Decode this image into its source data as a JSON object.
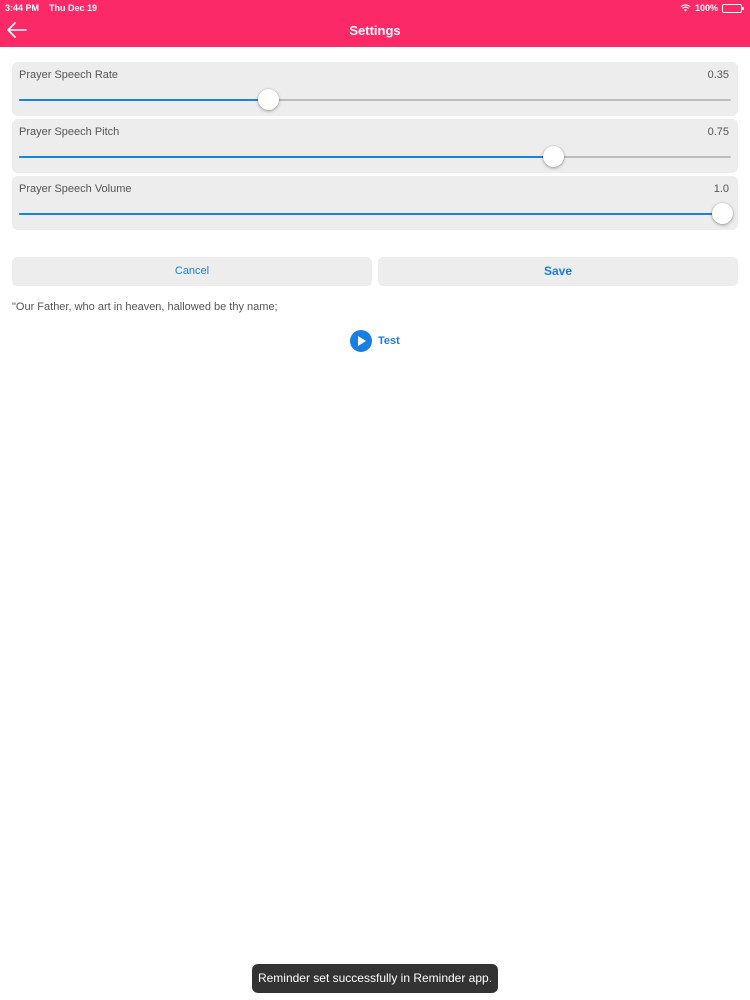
{
  "status_bar": {
    "time": "3:44 PM",
    "date": "Thu Dec 19",
    "battery": "100%"
  },
  "header": {
    "title": "Settings",
    "color": "#fb2a66"
  },
  "sliders": [
    {
      "label": "Prayer Speech Rate",
      "value_text": "0.35",
      "value": 0.35
    },
    {
      "label": "Prayer Speech Pitch",
      "value_text": "0.75",
      "value": 0.75
    },
    {
      "label": "Prayer Speech Volume",
      "value_text": "1.0",
      "value": 1.0
    }
  ],
  "buttons": {
    "cancel": "Cancel",
    "save": "Save"
  },
  "prayer_text": "\"Our Father, who art in heaven, hallowed be thy name;",
  "test_label": "Test",
  "toast": "Reminder set successfully in Reminder app.",
  "accent_color": "#1a7fe0"
}
